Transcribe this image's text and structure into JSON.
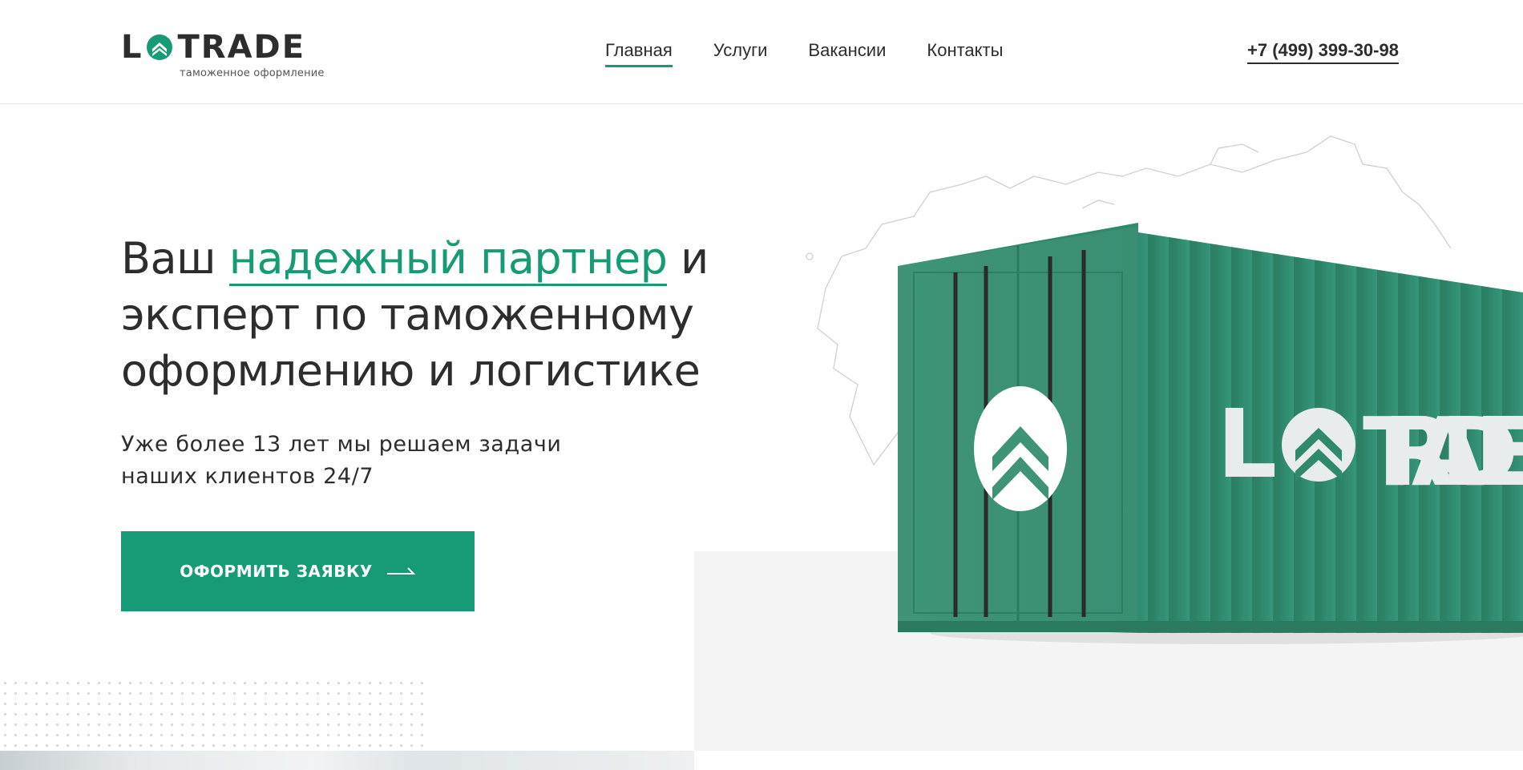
{
  "header": {
    "logo": {
      "text_left": "L",
      "text_right": "TRADE",
      "subtitle": "таможенное оформление"
    },
    "nav": [
      {
        "label": "Главная",
        "active": true
      },
      {
        "label": "Услуги",
        "active": false
      },
      {
        "label": "Вакансии",
        "active": false
      },
      {
        "label": "Контакты",
        "active": false
      }
    ],
    "phone": "+7 (499) 399-30-98"
  },
  "hero": {
    "title_part1": "Ваш ",
    "title_accent": "надежный партнер",
    "title_part2": " и эксперт по таможенному оформлению и логистике",
    "subtitle_line1": "Уже более 13 лет мы решаем задачи",
    "subtitle_line2": "наших клиентов 24/7",
    "cta_label": "ОФОРМИТЬ ЗАЯВКУ",
    "container_text_left": "L",
    "container_text_right": "TRADE"
  },
  "colors": {
    "accent": "#179b76",
    "text": "#2d2d2d",
    "container": "#2f8a6c"
  },
  "icons": {
    "logo_mark": "chevron-up-circle-icon",
    "cta_arrow": "arrow-right-icon"
  }
}
